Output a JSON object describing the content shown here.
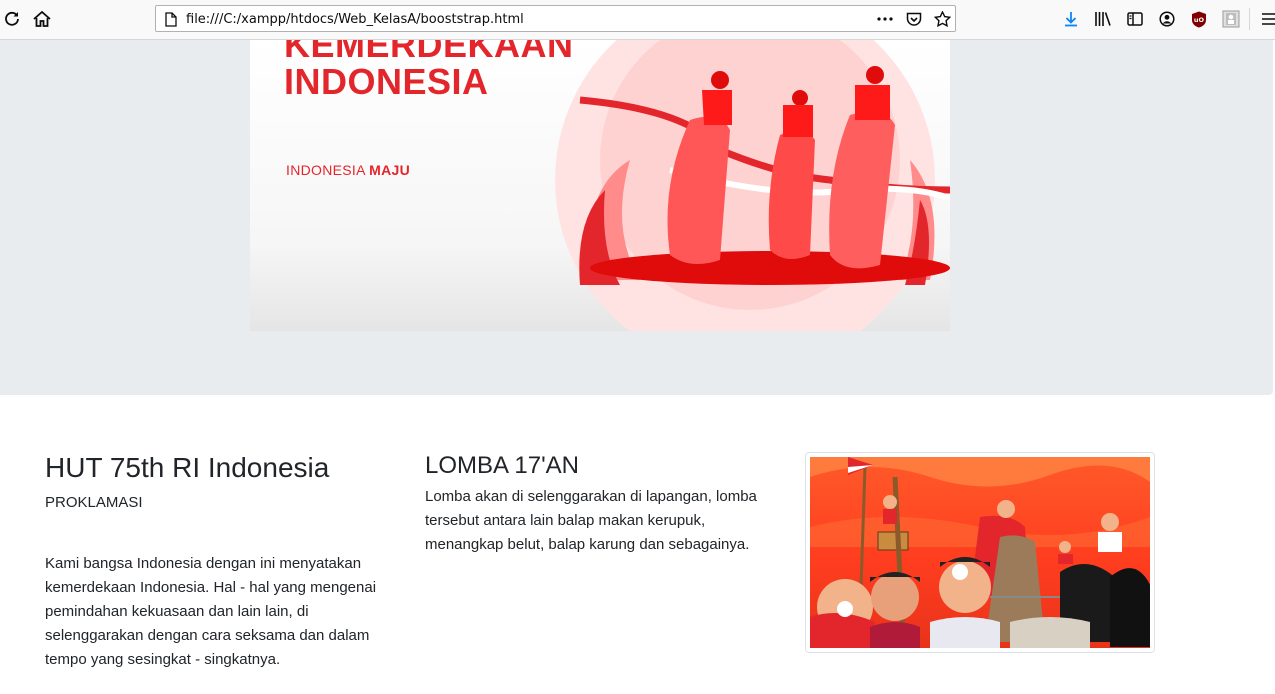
{
  "browser": {
    "url": "file:///C:/xampp/htdocs/Web_KelasA/booststrap.html",
    "icons": [
      "reload-icon",
      "home-icon",
      "page-icon",
      "more-icon",
      "pocket-icon",
      "bookmark-star-icon",
      "download-icon",
      "library-icon",
      "sidebar-icon",
      "account-icon",
      "ublock-icon",
      "extension-icon",
      "menu-icon"
    ]
  },
  "banner": {
    "title_line1": "KEMERDEKAAN",
    "title_line2": "INDONESIA",
    "subtitle_prefix": "INDONESIA ",
    "subtitle_bold": "MAJU"
  },
  "col1": {
    "heading": "HUT 75th RI Indonesia",
    "subheading": "PROKLAMASI",
    "text": "Kami bangsa Indonesia dengan ini menyatakan kemerdekaan Indonesia. Hal - hal yang mengenai pemindahan kekuasaan dan lain lain, di selenggarakan dengan cara seksama dan dalam tempo yang sesingkat - singkatnya."
  },
  "col2": {
    "heading": "LOMBA 17'AN",
    "text": "Lomba akan di selenggarakan di lapangan, lomba tersebut antara lain balap makan kerupuk, menangkap belut, balap karung dan sebagainya."
  },
  "colors": {
    "accent_red": "#e3262b",
    "jumbotron_bg": "#e9ecef",
    "illustration_orange": "#ff5a2a"
  }
}
